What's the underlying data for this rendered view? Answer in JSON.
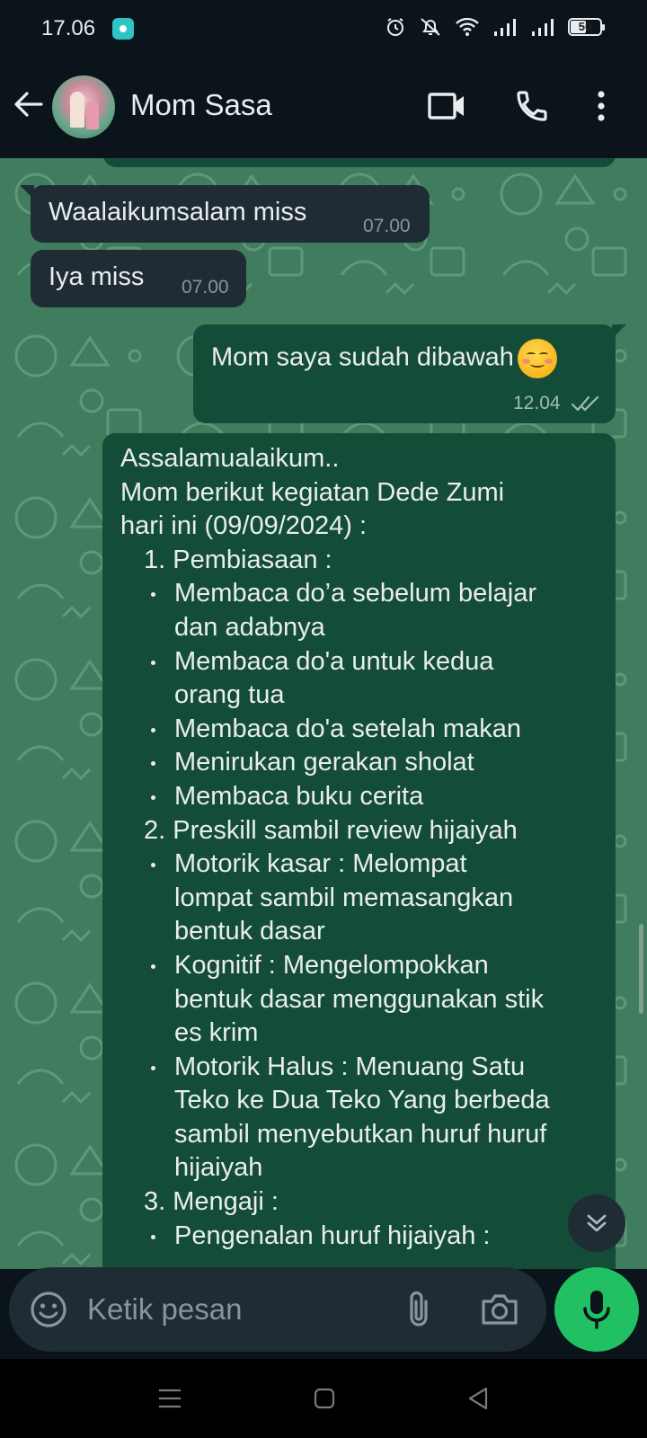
{
  "status_bar": {
    "time": "17.06",
    "battery": "50"
  },
  "header": {
    "contact_name": "Mom Sasa"
  },
  "messages": [
    {
      "dir": "in",
      "text": "Waalaikumsalam miss",
      "time": "07.00"
    },
    {
      "dir": "in",
      "text": "Iya miss",
      "time": "07.00"
    },
    {
      "dir": "out",
      "text": "Mom saya sudah dibawah",
      "time": "12.04",
      "emoji": "smiling-face-icon",
      "read": true
    },
    {
      "dir": "out",
      "lines": [
        "Assalamualaikum..",
        "Mom berikut kegiatan Dede Zumi",
        "hari ini (09/09/2024) :",
        "1. Pembiasaan :",
        "Membaca do’a sebelum belajar",
        "dan adabnya",
        "Membaca do'a untuk kedua",
        "orang tua",
        "Membaca do'a setelah makan",
        "Menirukan gerakan sholat",
        "Membaca buku cerita",
        "2. Preskill sambil review hijaiyah",
        "Motorik kasar :  Melompat",
        "lompat sambil memasangkan",
        "bentuk dasar",
        "Kognitif : Mengelompokkan",
        "bentuk dasar menggunakan stik",
        "es krim",
        "Motorik Halus :   Menuang Satu",
        "Teko ke Dua Teko Yang berbeda",
        "sambil menyebutkan huruf huruf",
        "hijaiyah",
        "3. Mengaji :",
        "Pengenalan huruf hijaiyah :"
      ]
    }
  ],
  "composer": {
    "placeholder": "Ketik pesan"
  },
  "colors": {
    "incoming": "#1f2c34",
    "outgoing": "#144d37",
    "wallpaper": "#3f7d5e",
    "mic": "#21c063"
  }
}
